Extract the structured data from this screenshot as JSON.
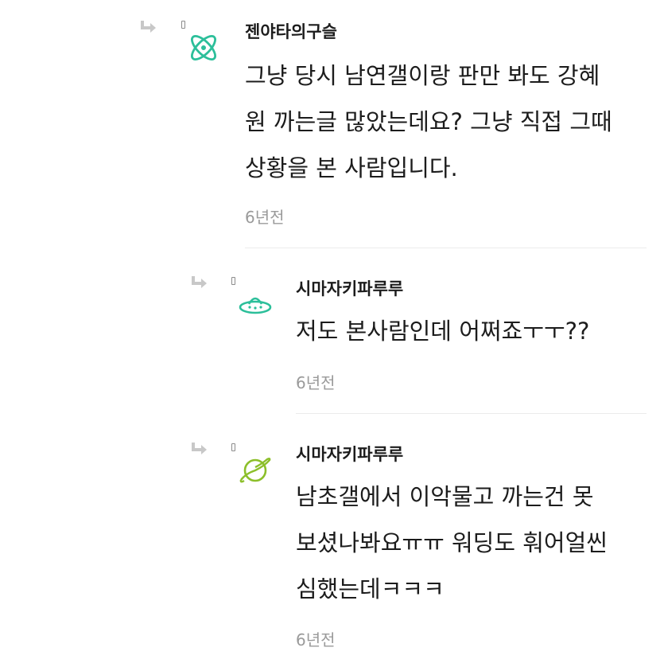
{
  "comments": [
    {
      "author": "젠야타의구슬",
      "lines": [
        "그냥 당시 남연갤이랑 판만 봐도 강혜",
        "원 까는글 많았는데요? 그냥 직접 그때",
        "상황을 본 사람입니다."
      ],
      "time": "6년전",
      "avatar_icon": "atom-icon",
      "avatar_color": "#2cbf9a"
    },
    {
      "author": "시마자키파루루",
      "lines": [
        "저도 본사람인데 어쩌죠ㅜㅜ??"
      ],
      "time": "6년전",
      "avatar_icon": "ufo-icon",
      "avatar_color": "#2cbf9a"
    },
    {
      "author": "시마자키파루루",
      "lines": [
        "남초갤에서 이악물고 까는건 못",
        "보셨나봐요ㅠㅠ 워딩도 훠어얼씬",
        "심했는데ㅋㅋㅋ"
      ],
      "time": "6년전",
      "avatar_icon": "planet-icon",
      "avatar_color": "#8cbf2a"
    }
  ],
  "colors": {
    "reply_arrow": "#c8c8c8",
    "time_text": "#9a9a9a",
    "divider": "#ebebeb"
  }
}
